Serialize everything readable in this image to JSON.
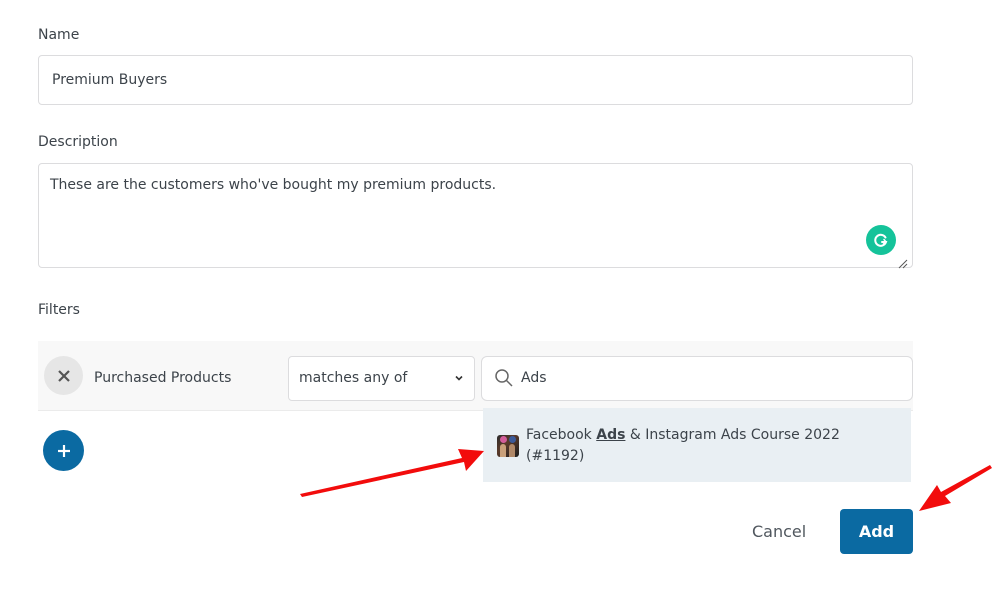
{
  "form": {
    "name_label": "Name",
    "name_value": "Premium Buyers",
    "description_label": "Description",
    "description_value": "These are the customers who've bought my premium products.",
    "filters_label": "Filters"
  },
  "filter": {
    "type": "Purchased Products",
    "operator": "matches any of",
    "search_value": "Ads"
  },
  "dropdown": {
    "option_prefix": "Facebook ",
    "option_match": "Ads",
    "option_suffix": " & Instagram Ads Course 2022",
    "option_id": "(#1192)"
  },
  "actions": {
    "cancel_label": "Cancel",
    "add_label": "Add"
  },
  "icons": {
    "grammarly": "grammarly-icon",
    "remove": "close-icon",
    "chevron": "chevron-down-icon",
    "search": "search-icon",
    "add_filter": "plus-icon",
    "annotation": "red-arrow-annotation"
  },
  "colors": {
    "primary": "#0b6aa2",
    "grammarly": "#15c39a",
    "dropdown_highlight": "#e9eff3",
    "annotation": "#f20c0c"
  }
}
